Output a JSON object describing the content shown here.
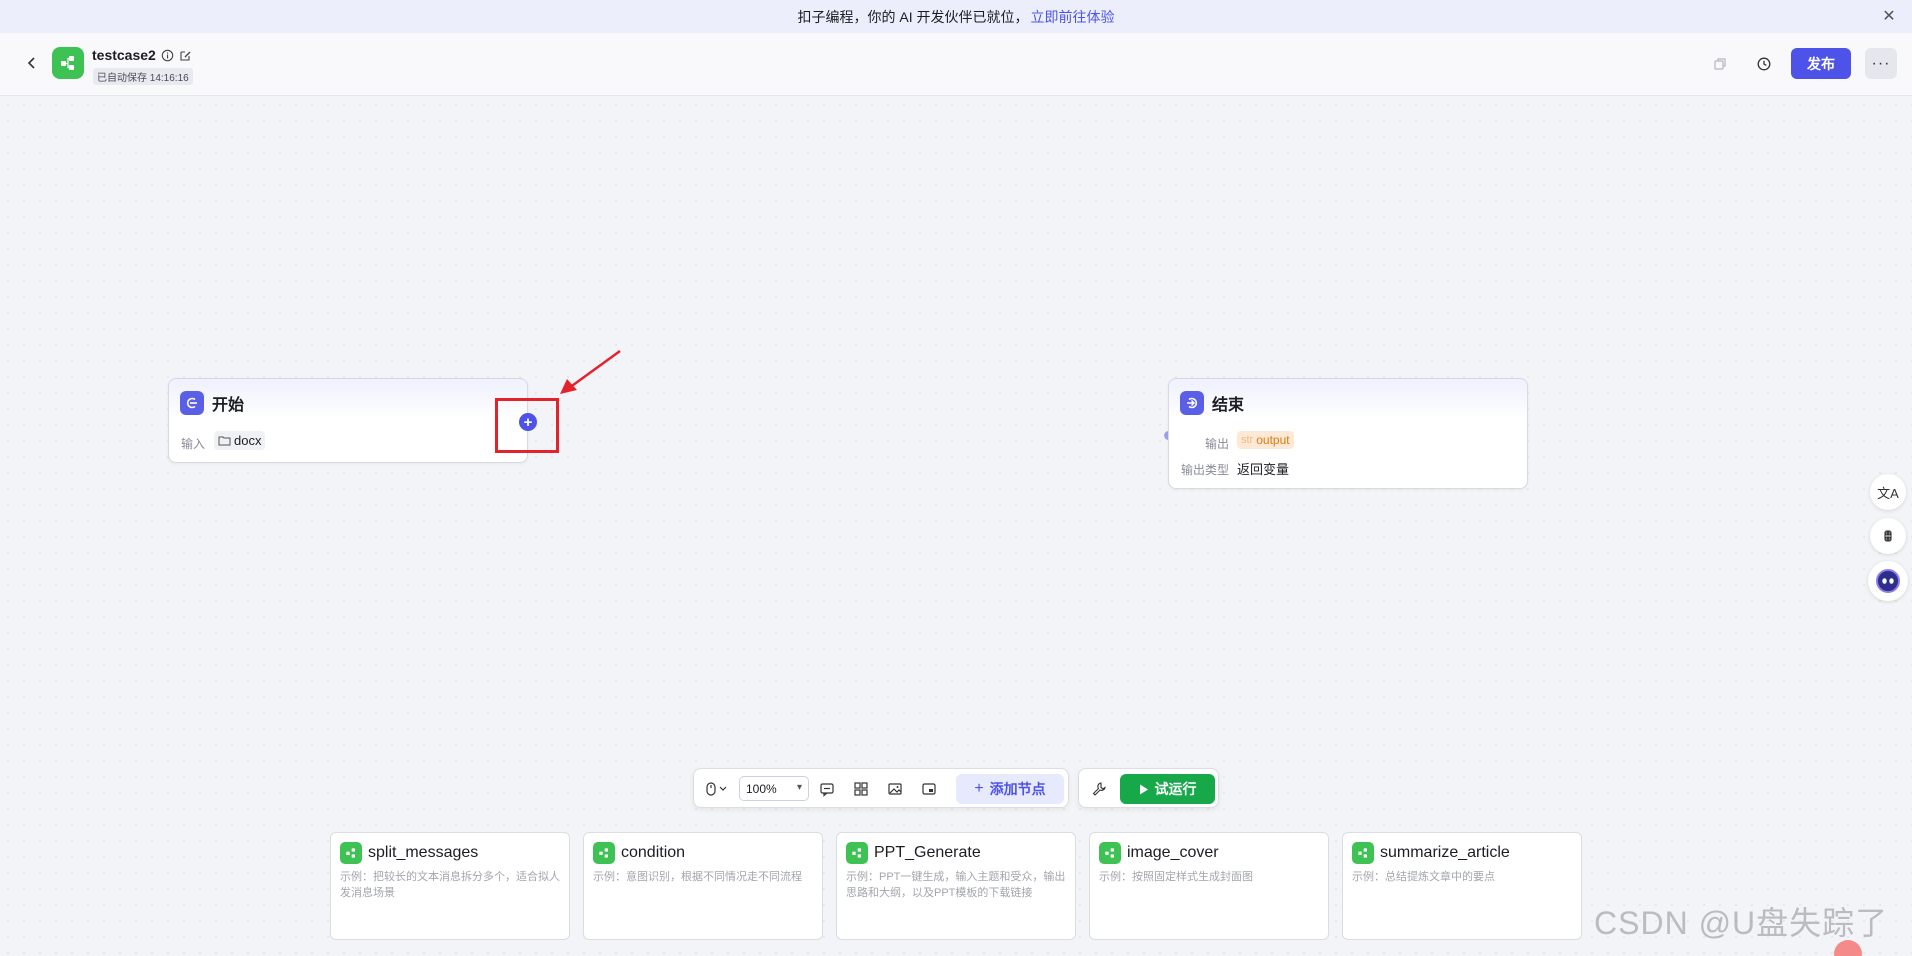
{
  "banner": {
    "text": "扣子编程，你的 AI 开发伙伴已就位，",
    "link": "立即前往体验",
    "close_icon": "close-icon"
  },
  "header": {
    "title": "testcase2",
    "saved": "已自动保存 14:16:16",
    "publish_label": "发布",
    "more_label": "···"
  },
  "nodes": {
    "start": {
      "title": "开始",
      "input_label": "输入",
      "input_value": "docx"
    },
    "end": {
      "title": "结束",
      "output_label": "输出",
      "output_prefix": "str",
      "output_value": "output",
      "output_type_label": "输出类型",
      "output_type_value": "返回变量"
    }
  },
  "toolbar": {
    "zoom": "100%",
    "add_node_label": "添加节点",
    "run_label": "试运行"
  },
  "templates": [
    {
      "title": "split_messages",
      "desc": "示例：把较长的文本消息拆分多个，适合拟人发消息场景"
    },
    {
      "title": "condition",
      "desc": "示例：意图识别，根据不同情况走不同流程"
    },
    {
      "title": "PPT_Generate",
      "desc": "示例：PPT一键生成，输入主题和受众，输出思路和大纲，以及PPT模板的下载链接"
    },
    {
      "title": "image_cover",
      "desc": "示例：按照固定样式生成封面图"
    },
    {
      "title": "summarize_article",
      "desc": "示例：总结提炼文章中的要点"
    }
  ],
  "watermark": "CSDN @U盘失踪了",
  "colors": {
    "accent": "#4d53e8",
    "run": "#17a84a",
    "brand_green": "#3ec254",
    "highlight": "#e3232c"
  }
}
